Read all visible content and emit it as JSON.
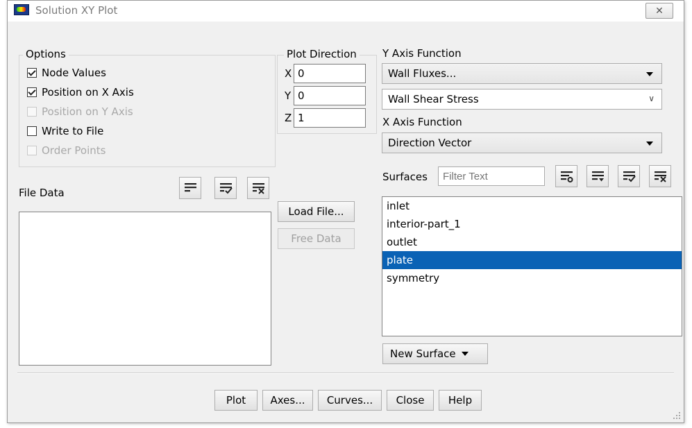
{
  "window": {
    "title": "Solution XY Plot",
    "close_glyph": "✕"
  },
  "options": {
    "title": "Options",
    "items": [
      {
        "label": "Node Values",
        "checked": true,
        "enabled": true
      },
      {
        "label": "Position on X Axis",
        "checked": true,
        "enabled": true
      },
      {
        "label": "Position on Y Axis",
        "checked": false,
        "enabled": false
      },
      {
        "label": "Write to File",
        "checked": false,
        "enabled": true
      },
      {
        "label": "Order Points",
        "checked": false,
        "enabled": false
      }
    ]
  },
  "plot_direction": {
    "title": "Plot Direction",
    "x_label": "X",
    "x_value": "0",
    "y_label": "Y",
    "y_value": "0",
    "z_label": "Z",
    "z_value": "1"
  },
  "y_axis": {
    "label": "Y Axis Function",
    "category": "Wall Fluxes...",
    "function": "Wall Shear Stress"
  },
  "x_axis": {
    "label": "X Axis Function",
    "function": "Direction Vector"
  },
  "surfaces": {
    "label": "Surfaces",
    "filter_placeholder": "Filter Text",
    "items": [
      "inlet",
      "interior-part_1",
      "outlet",
      "plate",
      "symmetry"
    ],
    "selected": "plate",
    "new_surface_label": "New Surface"
  },
  "file_data": {
    "label": "File Data",
    "load_label": "Load File...",
    "free_label": "Free Data"
  },
  "buttons": {
    "plot": "Plot",
    "axes": "Axes...",
    "curves": "Curves...",
    "close": "Close",
    "help": "Help"
  },
  "colors": {
    "selection": "#0a62b5",
    "window_bg": "#f0f0f0"
  }
}
